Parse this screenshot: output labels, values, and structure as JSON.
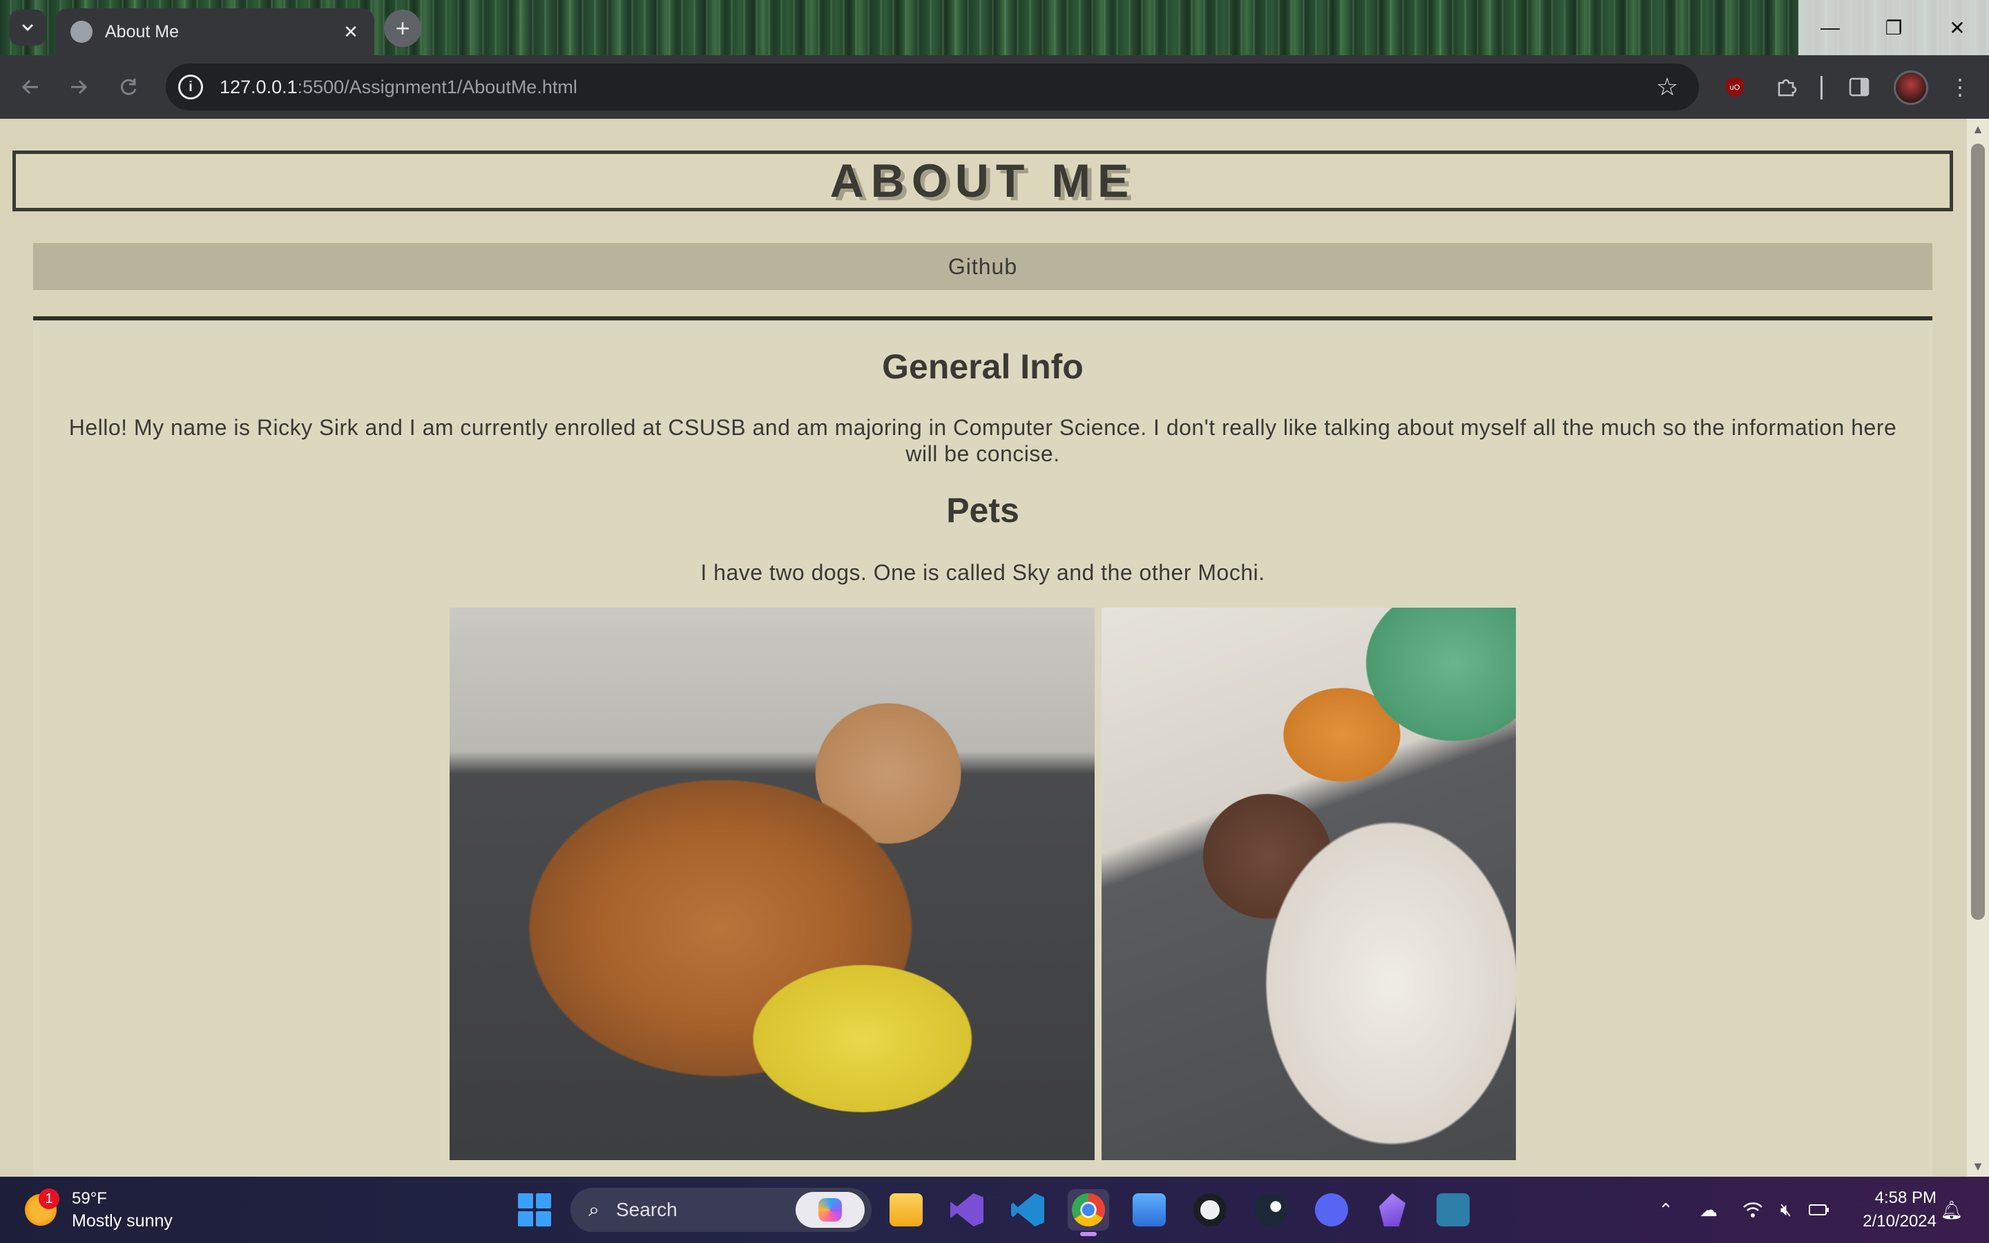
{
  "browser": {
    "tab_title": "About Me",
    "url_host": "127.0.0.1",
    "url_path": ":5500/Assignment1/AboutMe.html"
  },
  "page": {
    "heading": "ABOUT ME",
    "nav_link": "Github",
    "general_title": "General Info",
    "general_text": "Hello! My name is Ricky Sirk and I am currently enrolled at CSUSB and am majoring in Computer Science. I don't really like talking about myself all the much so the information here will be concise.",
    "pets_title": "Pets",
    "pets_text": "I have two dogs. One is called Sky and the other Mochi."
  },
  "taskbar": {
    "weather_temp": "59°F",
    "weather_condition": "Mostly sunny",
    "weather_badge": "1",
    "search_label": "Search",
    "time": "4:58 PM",
    "date": "2/10/2024"
  },
  "colors": {
    "page_background": "#d9d4b9",
    "nav_bar": "#b9b39d",
    "heading_text": "#3b3a33"
  }
}
